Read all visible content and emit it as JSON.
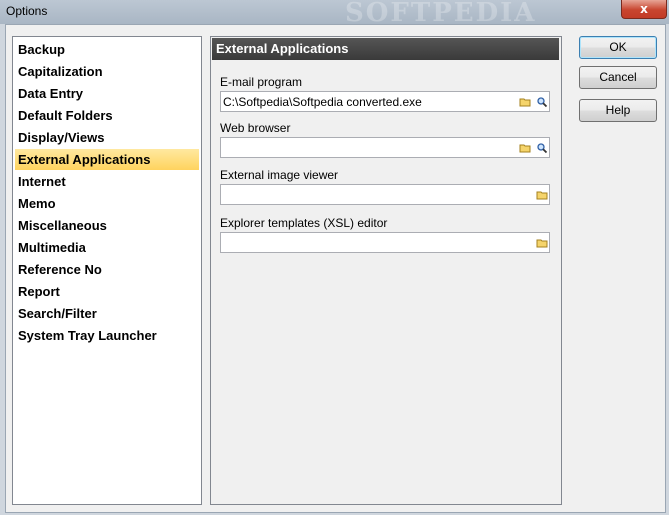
{
  "window": {
    "title": "Options",
    "watermark": "SOFTPEDIA",
    "close_symbol": "x"
  },
  "categories": [
    {
      "label": "Backup"
    },
    {
      "label": "Capitalization"
    },
    {
      "label": "Data Entry"
    },
    {
      "label": "Default Folders"
    },
    {
      "label": "Display/Views"
    },
    {
      "label": "External Applications",
      "selected": true
    },
    {
      "label": "Internet"
    },
    {
      "label": "Memo"
    },
    {
      "label": "Miscellaneous"
    },
    {
      "label": "Multimedia"
    },
    {
      "label": "Reference No"
    },
    {
      "label": "Report"
    },
    {
      "label": "Search/Filter"
    },
    {
      "label": "System Tray Launcher"
    }
  ],
  "panel": {
    "title": "External Applications",
    "fields": [
      {
        "label": "E-mail program",
        "value": "C:\\Softpedia\\Softpedia converted.exe",
        "icons": [
          "folder-icon",
          "search-icon"
        ]
      },
      {
        "label": "Web browser",
        "value": "",
        "icons": [
          "folder-icon",
          "search-icon"
        ]
      },
      {
        "label": "External image viewer",
        "value": "",
        "icons": [
          "folder-icon"
        ]
      },
      {
        "label": "Explorer templates (XSL) editor",
        "value": "",
        "icons": [
          "folder-icon"
        ]
      }
    ]
  },
  "buttons": {
    "ok": "OK",
    "cancel": "Cancel",
    "help": "Help"
  },
  "colors": {
    "selection": "#ffd35e",
    "header_bg": "#3a3a3a",
    "close": "#c8452f"
  }
}
